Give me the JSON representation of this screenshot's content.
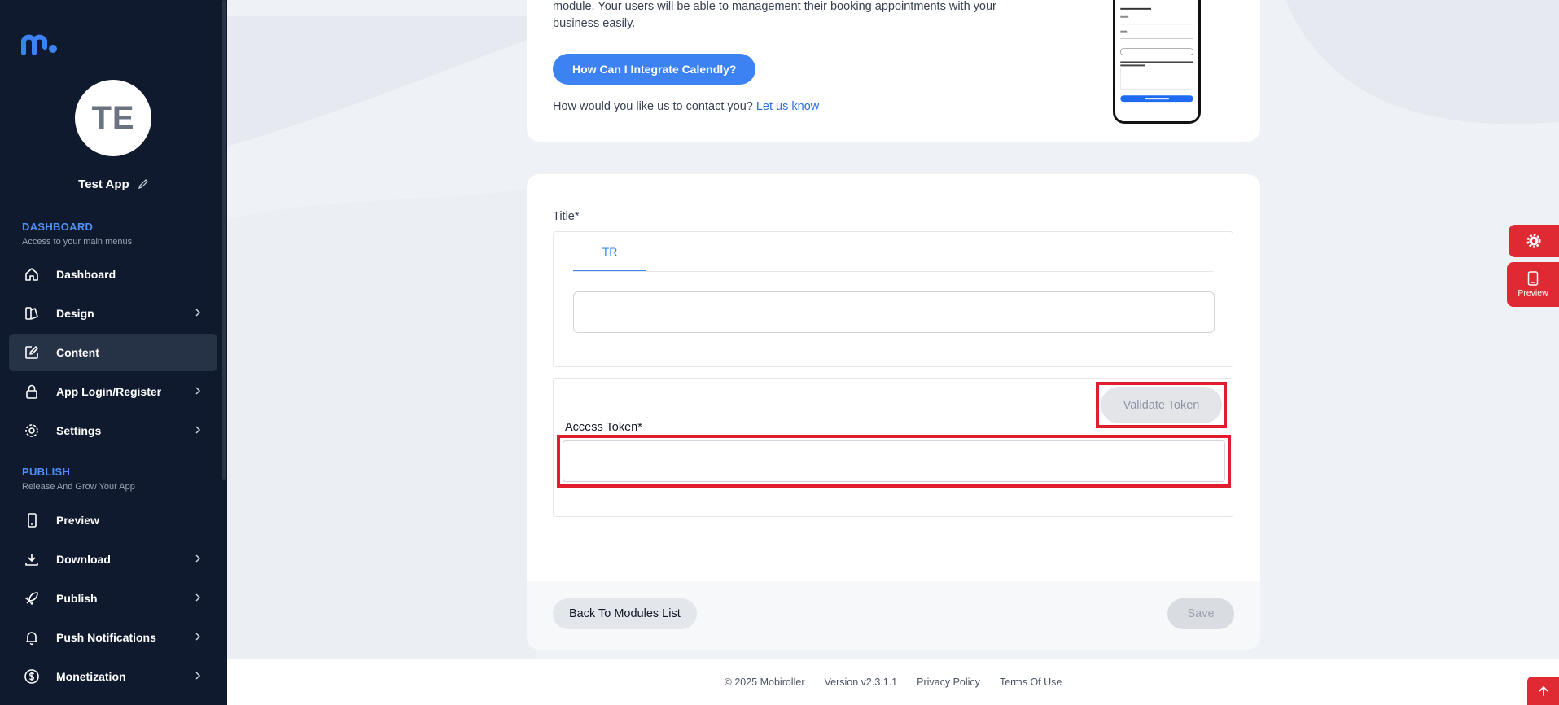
{
  "sidebar": {
    "app_initials": "TE",
    "app_name": "Test App",
    "sections": {
      "dashboard_title": "DASHBOARD",
      "dashboard_sub": "Access to your main menus",
      "publish_title": "PUBLISH",
      "publish_sub": "Release And Grow Your App"
    },
    "items": {
      "dashboard": "Dashboard",
      "design": "Design",
      "content": "Content",
      "login": "App Login/Register",
      "settings": "Settings",
      "preview": "Preview",
      "download": "Download",
      "publish": "Publish",
      "push": "Push Notifications",
      "monetization": "Monetization"
    },
    "active_item": "Content"
  },
  "intro": {
    "description": "module. Your users will be able to management their booking appointments with your business easily.",
    "integrate_button": "How Can I Integrate Calendly?",
    "contact_text": "How would you like us to contact you?",
    "contact_link": "Let us know"
  },
  "form": {
    "title_label": "Title*",
    "language_tab": "TR",
    "title_value": "",
    "validate_button": "Validate Token",
    "token_label": "Access Token*",
    "token_value": "",
    "back_button": "Back To Modules List",
    "save_button": "Save"
  },
  "floating": {
    "preview_label": "Preview"
  },
  "footer": {
    "copyright": "© 2025 Mobiroller",
    "version": "Version v2.3.1.1",
    "privacy": "Privacy Policy",
    "terms": "Terms Of Use"
  },
  "colors": {
    "sidebar_bg": "#0f1a2e",
    "accent_blue": "#3d82f2",
    "highlight_red": "#e01e2d",
    "fab_red": "#e02a33"
  },
  "icons": {
    "logo": "mobiroller-logo",
    "edit": "pencil-icon",
    "dashboard": "home-icon",
    "design": "palette-icon",
    "content": "edit-square-icon",
    "login": "lock-icon",
    "settings": "gear-icon",
    "preview": "phone-icon",
    "download": "download-icon",
    "publish": "rocket-icon",
    "push": "bell-icon",
    "monetization": "dollar-icon",
    "chevron": "chevron-right-icon",
    "scroll_top": "arrow-up-icon"
  }
}
